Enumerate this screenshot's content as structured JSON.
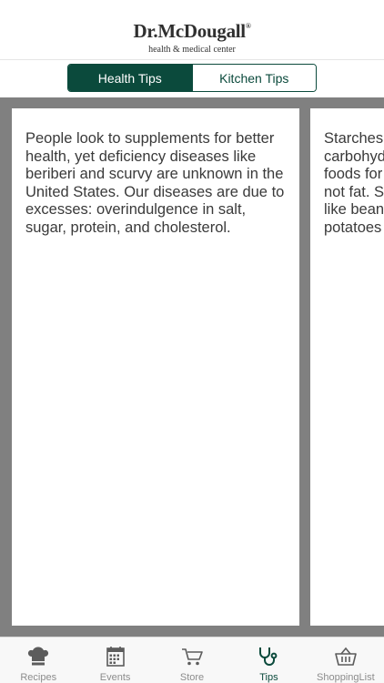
{
  "header": {
    "brand": "Dr.McDougall",
    "brand_mark": "®",
    "subtitle": "health & medical center"
  },
  "segments": [
    {
      "label": "Health Tips",
      "active": true
    },
    {
      "label": "Kitchen Tips",
      "active": false
    }
  ],
  "tips": [
    {
      "text": "People look to supplements for better health, yet deficiency diseases like beriberi and scurvy are unknown in the United States. Our diseases are due to excesses: overindulgence in salt, sugar, protein, and cholesterol."
    },
    {
      "text": "Starches carbohyd foods for not fat. S like bean potatoes"
    }
  ],
  "tabbar": {
    "items": [
      {
        "label": "Recipes",
        "icon": "chef-hat-icon"
      },
      {
        "label": "Events",
        "icon": "calendar-icon"
      },
      {
        "label": "Store",
        "icon": "cart-icon"
      },
      {
        "label": "Tips",
        "icon": "stethoscope-icon",
        "active": true
      },
      {
        "label": "ShoppingList",
        "icon": "basket-icon"
      }
    ]
  },
  "colors": {
    "accent": "#0b4a3c",
    "background_gray": "#808080",
    "inactive_tab": "#8c8c8c"
  }
}
